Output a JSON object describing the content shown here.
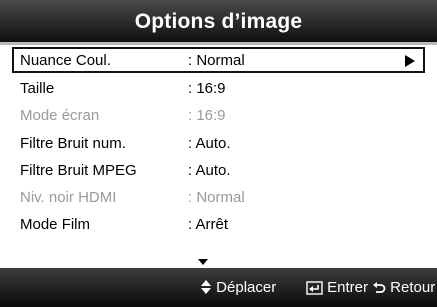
{
  "title": "Options d’image",
  "rows": [
    {
      "label": "Nuance Coul.",
      "value": ": Normal",
      "enabled": true,
      "selected": true
    },
    {
      "label": "Taille",
      "value": ": 16:9",
      "enabled": true,
      "selected": false
    },
    {
      "label": "Mode écran",
      "value": ": 16:9",
      "enabled": false,
      "selected": false
    },
    {
      "label": "Filtre Bruit num.",
      "value": ": Auto.",
      "enabled": true,
      "selected": false
    },
    {
      "label": "Filtre Bruit MPEG",
      "value": ": Auto.",
      "enabled": true,
      "selected": false
    },
    {
      "label": "Niv. noir HDMI",
      "value": ": Normal",
      "enabled": false,
      "selected": false
    },
    {
      "label": "Mode Film",
      "value": ": Arrêt",
      "enabled": true,
      "selected": false
    }
  ],
  "icons": {
    "submenu": "triangle-right-icon",
    "more_below": "triangle-down-icon",
    "move": "up-down-arrow-icon",
    "enter": "enter-icon",
    "return": "return-icon"
  },
  "footer": {
    "move_label": "Déplacer",
    "enter_label": "Entrer",
    "return_label": "Retour"
  }
}
